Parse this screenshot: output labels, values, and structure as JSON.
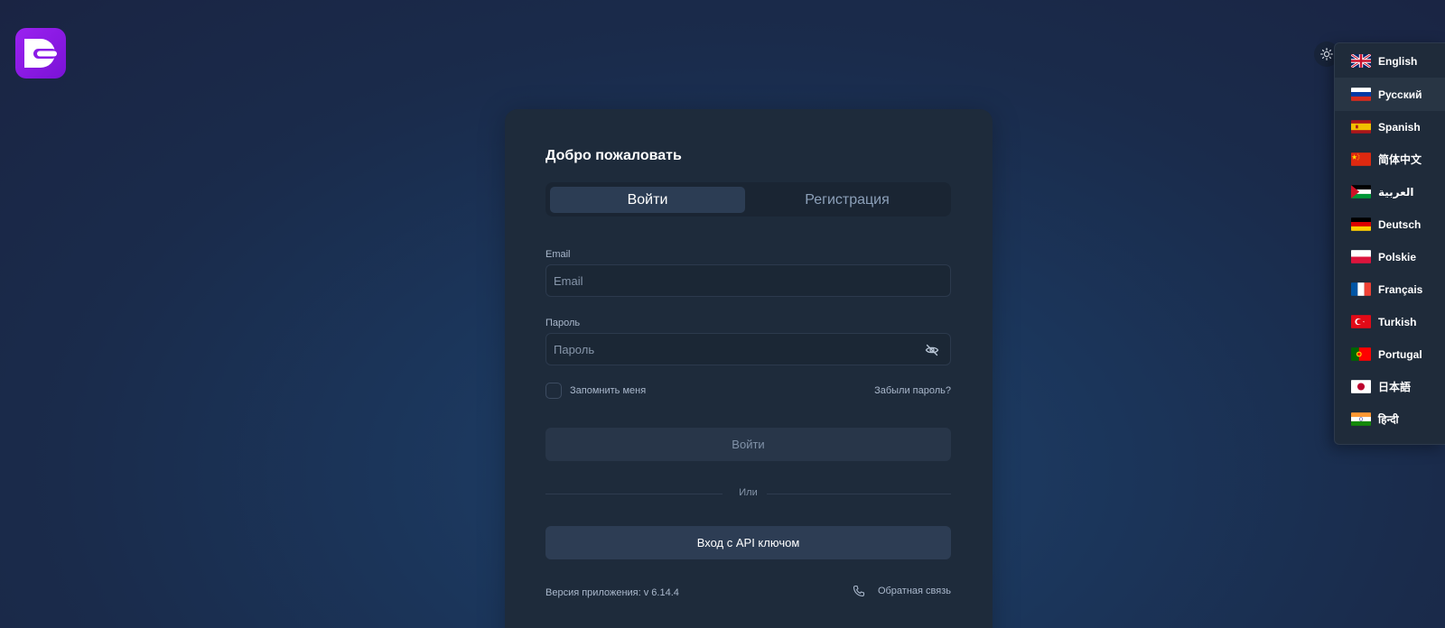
{
  "auth": {
    "welcome_title": "Добро пожаловать",
    "tabs": [
      {
        "label": "Войти",
        "active": true
      },
      {
        "label": "Регистрация",
        "active": false
      }
    ],
    "email": {
      "label": "Email",
      "placeholder": "Email",
      "value": ""
    },
    "password": {
      "label": "Пароль",
      "placeholder": "Пароль",
      "value": ""
    },
    "remember_me": {
      "label": "Запомнить меня",
      "checked": false
    },
    "forgot_password": "Забыли пароль?",
    "login_button": "Войти",
    "divider": "Или",
    "api_login_button": "Вход с API ключом",
    "version": "Версия приложения: v 6.14.4",
    "feedback": "Обратная связь"
  },
  "header": {
    "logo_icon": "brand-logo-icon",
    "theme_icon": "sun-icon"
  },
  "language_menu": {
    "selected": "Русский",
    "items": [
      {
        "label": "English",
        "flag": "gb"
      },
      {
        "label": "Русский",
        "flag": "ru"
      },
      {
        "label": "Spanish",
        "flag": "es"
      },
      {
        "label": "简体中文",
        "flag": "cn"
      },
      {
        "label": "العربية",
        "flag": "ps"
      },
      {
        "label": "Deutsch",
        "flag": "de"
      },
      {
        "label": "Polskie",
        "flag": "pl"
      },
      {
        "label": "Français",
        "flag": "fr"
      },
      {
        "label": "Turkish",
        "flag": "tr"
      },
      {
        "label": "Portugal",
        "flag": "pt"
      },
      {
        "label": "日本語",
        "flag": "jp"
      },
      {
        "label": "हिन्दी",
        "flag": "in"
      }
    ]
  },
  "colors": {
    "brand": "#8b1be6",
    "card": "#1e2b3b",
    "accent_button": "#2d3d54"
  }
}
